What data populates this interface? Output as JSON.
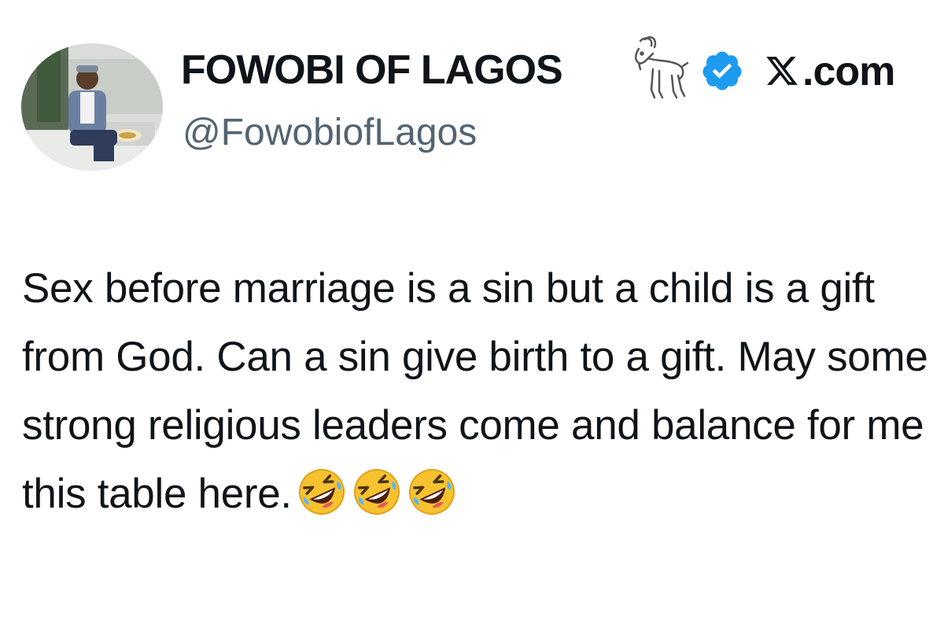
{
  "profile": {
    "display_name": "FOWOBI OF LAGOS",
    "handle": "@FowobiofLagos",
    "site_label": ".com",
    "icons": [
      "avatar-photo",
      "goat-icon",
      "verified-badge-icon",
      "x-logo-icon"
    ],
    "badge_color": "#1d9bf0"
  },
  "tweet": {
    "text": "Sex before marriage is a sin but a child is a gift from God. Can a sin give birth to a gift. May some strong religious leaders come and balance for me this table here.",
    "emojis": [
      "rolling-on-floor-laughing-emoji",
      "rolling-on-floor-laughing-emoji",
      "rolling-on-floor-laughing-emoji"
    ]
  }
}
